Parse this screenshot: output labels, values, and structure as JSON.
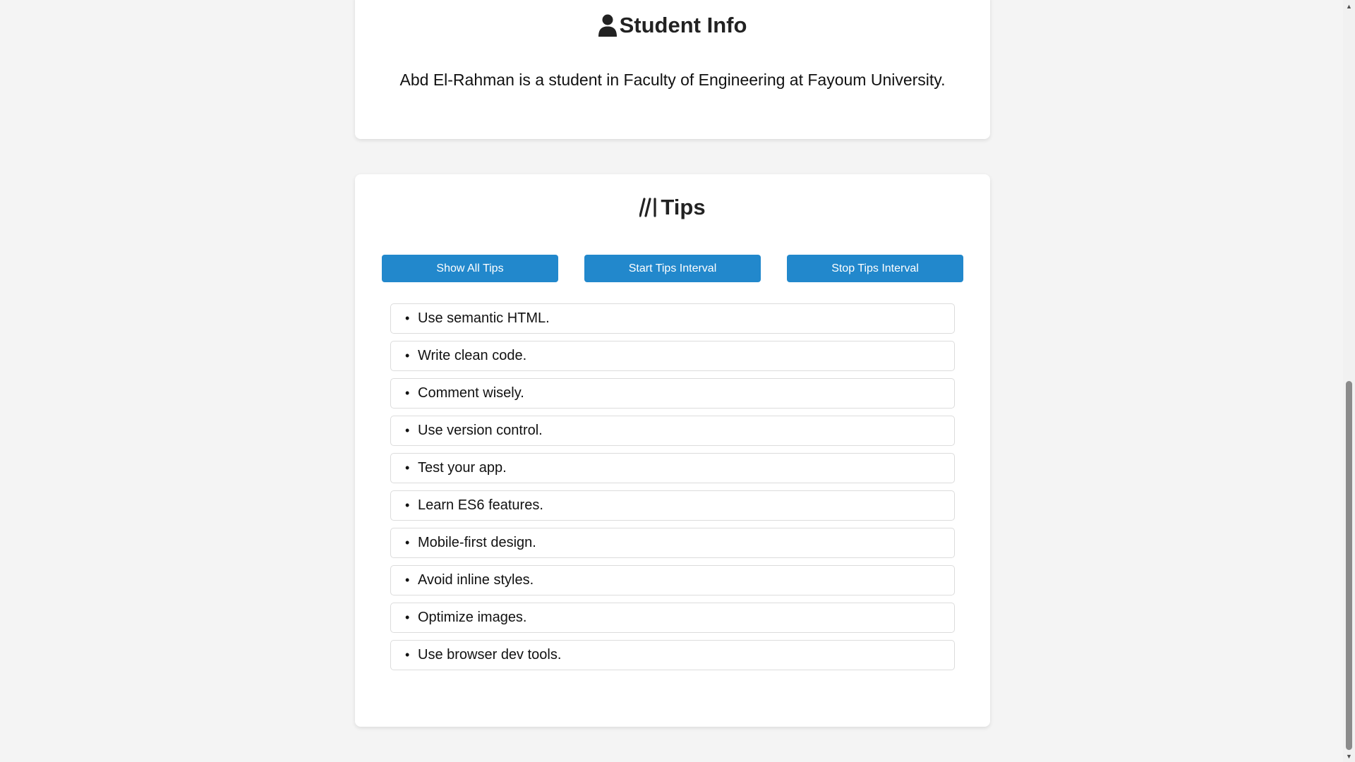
{
  "student": {
    "title": "Student Info",
    "icon": "user-icon",
    "text": "Abd El-Rahman is a student in Faculty of Engineering at Fayoum University."
  },
  "tips": {
    "title": "Tips",
    "icon": "tips-icon",
    "buttons": {
      "show_all": "Show All Tips",
      "start_interval": "Start Tips Interval",
      "stop_interval": "Stop Tips Interval"
    },
    "items": [
      "Use semantic HTML.",
      "Write clean code.",
      "Comment wisely.",
      "Use version control.",
      "Test your app.",
      "Learn ES6 features.",
      "Mobile-first design.",
      "Avoid inline styles.",
      "Optimize images.",
      "Use browser dev tools."
    ]
  },
  "colors": {
    "button": "#2288cc",
    "background": "#f4f4f4",
    "card": "#ffffff"
  }
}
